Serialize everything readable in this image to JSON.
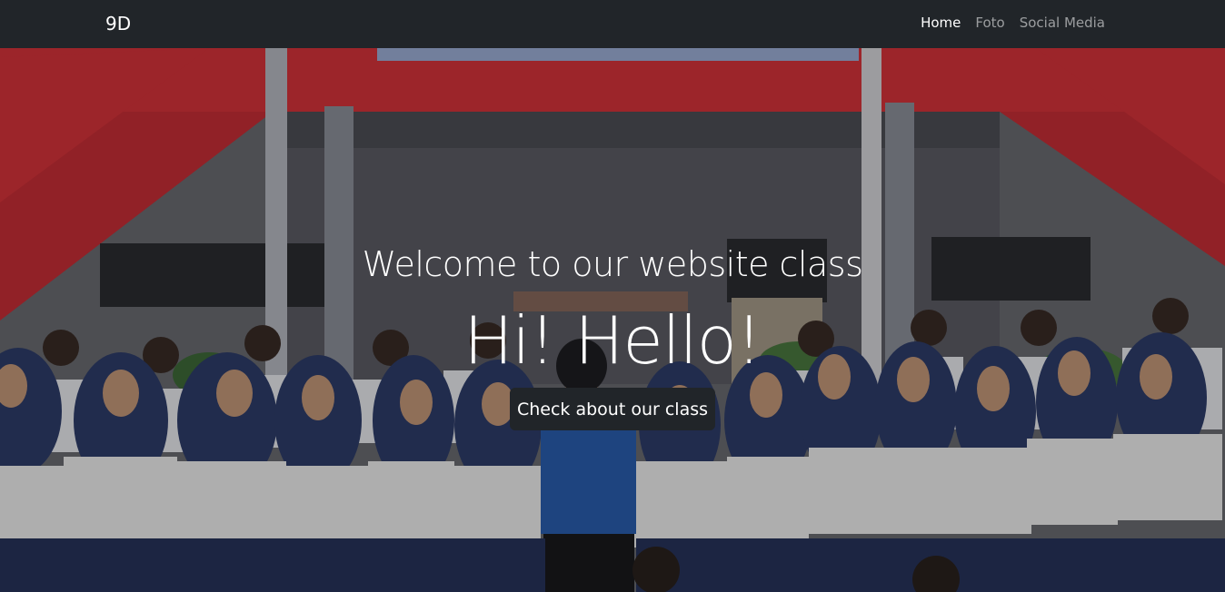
{
  "navbar": {
    "brand": "9D",
    "links": [
      {
        "label": "Home",
        "active": true
      },
      {
        "label": "Foto",
        "active": false
      },
      {
        "label": "Social Media",
        "active": false
      }
    ]
  },
  "hero": {
    "subtitle": "Welcome to our website class",
    "title": "Hi! Hello!",
    "button_label": "Check about our class",
    "background": "school-class-group-photo"
  },
  "colors": {
    "navbar_bg": "#212529",
    "building_red": "#d9343b",
    "uniform_navy": "#2f3d6b",
    "shirt_white": "#f2f2f2"
  }
}
